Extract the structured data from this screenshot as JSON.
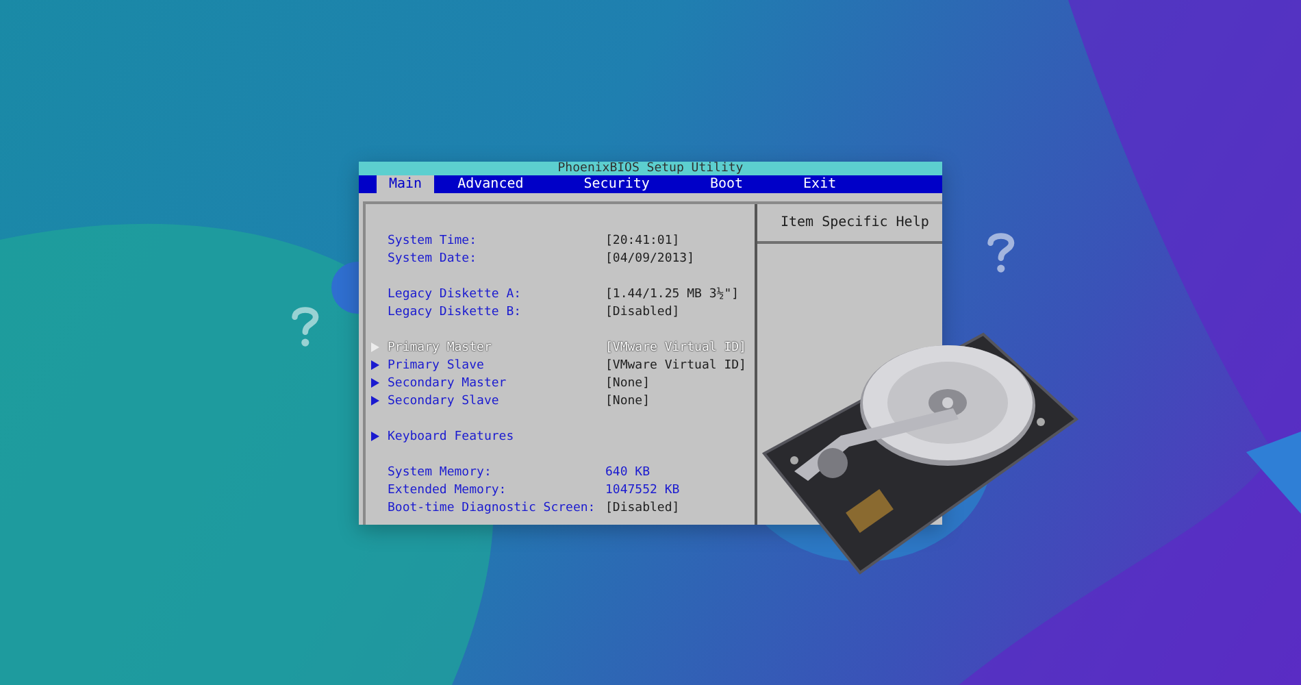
{
  "window": {
    "title": "PhoenixBIOS Setup Utility"
  },
  "tabs": [
    {
      "label": "Main",
      "selected": true
    },
    {
      "label": "Advanced",
      "selected": false
    },
    {
      "label": "Security",
      "selected": false
    },
    {
      "label": "Boot",
      "selected": false
    },
    {
      "label": "Exit",
      "selected": false
    }
  ],
  "groups": [
    [
      {
        "kind": "field",
        "label": "System Time:",
        "value": "[20:41:01]",
        "selected": false
      },
      {
        "kind": "field",
        "label": "System Date:",
        "value": "[04/09/2013]",
        "selected": false
      }
    ],
    [
      {
        "kind": "field",
        "label": "Legacy Diskette A:",
        "value": "[1.44/1.25 MB  3½\"]",
        "selected": false
      },
      {
        "kind": "field",
        "label": "Legacy Diskette B:",
        "value": "[Disabled]",
        "selected": false
      }
    ],
    [
      {
        "kind": "submenu",
        "label": "Primary Master",
        "value": "[VMware Virtual ID]",
        "selected": true
      },
      {
        "kind": "submenu",
        "label": "Primary Slave",
        "value": "[VMware Virtual ID]",
        "selected": false
      },
      {
        "kind": "submenu",
        "label": "Secondary Master",
        "value": "[None]",
        "selected": false
      },
      {
        "kind": "submenu",
        "label": "Secondary Slave",
        "value": "[None]",
        "selected": false
      }
    ],
    [
      {
        "kind": "submenu",
        "label": "Keyboard Features",
        "selected": false
      }
    ],
    [
      {
        "kind": "info",
        "label": "System Memory:",
        "value": "640 KB",
        "selected": false
      },
      {
        "kind": "info",
        "label": "Extended Memory:",
        "value": "1047552 KB",
        "selected": false
      },
      {
        "kind": "field",
        "label": "Boot-time Diagnostic Screen:",
        "value": "[Disabled]",
        "selected": false
      }
    ]
  ],
  "help_panel": {
    "title": "Item Specific Help"
  }
}
